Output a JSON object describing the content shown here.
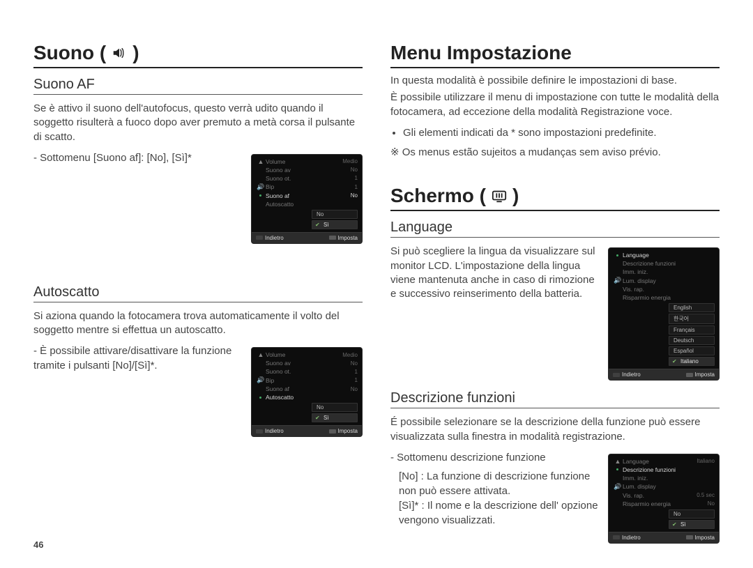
{
  "page_number": "46",
  "left": {
    "h1": "Suono (",
    "h1_close": ")",
    "section1": {
      "title": "Suono AF",
      "body": "Se è attivo il suono dell'autofocus, questo verrà udito quando il soggetto risulterà a fuoco dopo aver premuto a metà corsa il pulsante di scatto.",
      "subnote": "- Sottomenu [Suono af]: [No], [Sì]*",
      "screen": {
        "rows": [
          {
            "label": "Volume",
            "value": "Medio"
          },
          {
            "label": "Suono av",
            "value": "No"
          },
          {
            "label": "Suono ot.",
            "value": "1"
          },
          {
            "label": "Bip",
            "value": "1"
          },
          {
            "label": "Suono af",
            "value": "No",
            "selected": true
          },
          {
            "label": "Autoscatto",
            "value": ""
          }
        ],
        "options": [
          {
            "v": "No"
          },
          {
            "v": "Sì",
            "sel": true
          }
        ],
        "footer_left": "Indietro",
        "footer_right": "Imposta"
      }
    },
    "section2": {
      "title": "Autoscatto",
      "body": "Si aziona quando la fotocamera trova automaticamente il volto del soggetto mentre si effettua un autoscatto.",
      "subnote": "- È possibile attivare/disattivare la funzione tramite i pulsanti [No]/[Sì]*.",
      "screen": {
        "rows": [
          {
            "label": "Volume",
            "value": "Medio"
          },
          {
            "label": "Suono av",
            "value": "No"
          },
          {
            "label": "Suono ot.",
            "value": "1"
          },
          {
            "label": "Bip",
            "value": "1"
          },
          {
            "label": "Suono af",
            "value": "No"
          },
          {
            "label": "Autoscatto",
            "value": "",
            "selected": true
          }
        ],
        "options": [
          {
            "v": "No"
          },
          {
            "v": "Sì",
            "sel": true
          }
        ],
        "footer_left": "Indietro",
        "footer_right": "Imposta"
      }
    }
  },
  "right": {
    "h1a": "Menu Impostazione",
    "intro": [
      "In questa modalità è possibile definire le impostazioni di base.",
      "È possibile utilizzare il menu di impostazione con tutte le modalità della fotocamera, ad eccezione della modalità Registrazione voce."
    ],
    "bullet": "Gli elementi indicati da * sono impostazioni predefinite.",
    "note": "※ Os menus estão sujeitos a mudanças sem aviso prévio.",
    "h1b": "Schermo (",
    "h1b_close": ")",
    "section1": {
      "title": "Language",
      "body": "Si può scegliere la lingua da visualizzare sul monitor LCD. L'impostazione della lingua viene mantenuta anche in caso di rimozione e successivo reinserimento della batteria.",
      "screen": {
        "rows": [
          {
            "label": "Language",
            "value": "",
            "selected": true
          },
          {
            "label": "Descrizione funzioni",
            "value": ""
          },
          {
            "label": "Imm. iniz.",
            "value": ""
          },
          {
            "label": "Lum. display",
            "value": ""
          },
          {
            "label": "Vis. rap.",
            "value": ""
          },
          {
            "label": "Risparmio energia",
            "value": ""
          }
        ],
        "options": [
          {
            "v": "English"
          },
          {
            "v": "한국어"
          },
          {
            "v": "Français"
          },
          {
            "v": "Deutsch"
          },
          {
            "v": "Español"
          },
          {
            "v": "Italiano",
            "sel": true
          }
        ],
        "footer_left": "Indietro",
        "footer_right": "Imposta"
      }
    },
    "section2": {
      "title": "Descrizione funzioni",
      "body": "É possibile selezionare se la descrizione della funzione può essere visualizzata sulla finestra in modalità registrazione.",
      "sublabel": "- Sottomenu descrizione funzione",
      "defs": [
        {
          "key": "[No]",
          "sep": ":",
          "text": "La funzione di descrizione funzione non può essere attivata."
        },
        {
          "key": "[Sì]*",
          "sep": ":",
          "text": "Il nome e la descrizione dell' opzione vengono visualizzati."
        }
      ],
      "screen": {
        "rows": [
          {
            "label": "Language",
            "value": "Italiano"
          },
          {
            "label": "Descrizione funzioni",
            "value": "",
            "selected": true
          },
          {
            "label": "Imm. iniz.",
            "value": ""
          },
          {
            "label": "Lum. display",
            "value": ""
          },
          {
            "label": "Vis. rap.",
            "value": "0.5 sec"
          },
          {
            "label": "Risparmio energia",
            "value": "No"
          }
        ],
        "options": [
          {
            "v": "No"
          },
          {
            "v": "Sì",
            "sel": true
          }
        ],
        "footer_left": "Indietro",
        "footer_right": "Imposta"
      }
    }
  }
}
